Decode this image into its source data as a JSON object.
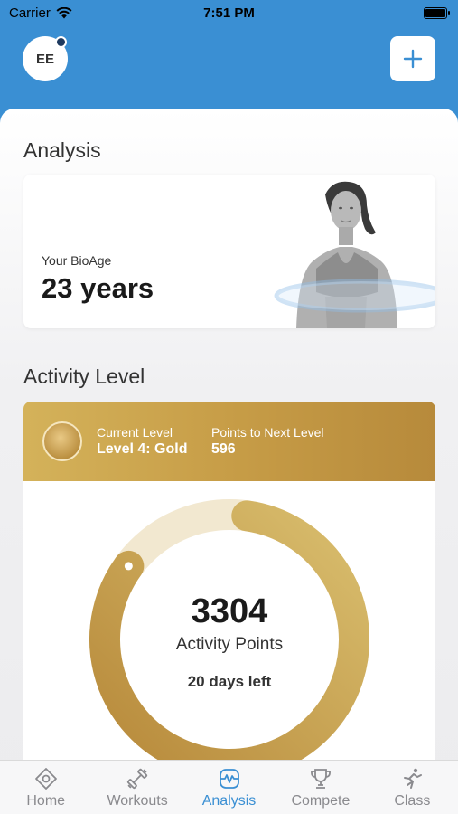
{
  "status_bar": {
    "carrier": "Carrier",
    "time": "7:51 PM"
  },
  "header": {
    "avatar_initials": "EE"
  },
  "analysis": {
    "title": "Analysis",
    "bioage_label": "Your BioAge",
    "bioage_value": "23 years"
  },
  "activity": {
    "title": "Activity Level",
    "current_level_caption": "Current Level",
    "current_level_value": "Level 4: Gold",
    "next_level_caption": "Points to Next Level",
    "next_level_value": "596",
    "points": "3304",
    "points_label": "Activity Points",
    "days_left": "20 days left",
    "progress_fraction": 0.85
  },
  "tabs": [
    {
      "label": "Home",
      "icon": "home-icon"
    },
    {
      "label": "Workouts",
      "icon": "dumbbell-icon"
    },
    {
      "label": "Analysis",
      "icon": "analysis-icon",
      "active": true
    },
    {
      "label": "Compete",
      "icon": "trophy-icon"
    },
    {
      "label": "Class",
      "icon": "runner-icon"
    }
  ],
  "colors": {
    "header_blue": "#3a8fd3",
    "gold": "#c79d47",
    "gold_light": "#f2e8d0",
    "tab_active": "#3a8fd3",
    "tab_inactive": "#8a8a8e"
  }
}
